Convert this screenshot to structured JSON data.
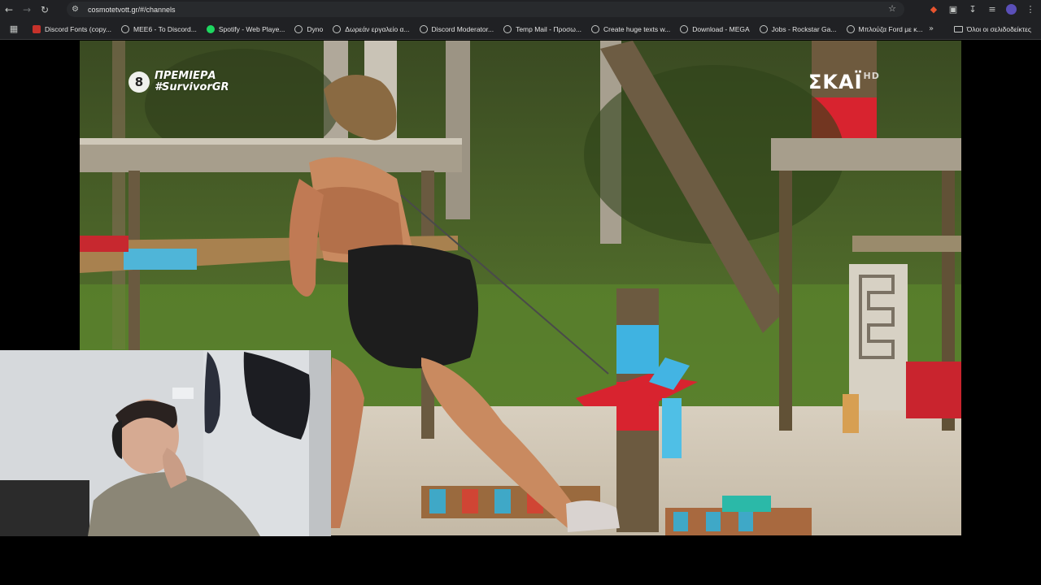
{
  "browser": {
    "url": "cosmotetvott.gr/#/channels",
    "bookmarks": [
      {
        "label": "Discord Fonts (copy...",
        "icon": "red-bookmark-icon"
      },
      {
        "label": "MEE6 - To Discord...",
        "icon": "globe-icon"
      },
      {
        "label": "Spotify - Web Playe...",
        "icon": "spotify-icon"
      },
      {
        "label": "Dyno",
        "icon": "globe-icon"
      },
      {
        "label": "Δωρεάν εργαλείο α...",
        "icon": "globe-icon"
      },
      {
        "label": "Discord Moderator...",
        "icon": "globe-icon"
      },
      {
        "label": "Temp Mail - Προσω...",
        "icon": "globe-icon"
      },
      {
        "label": "Create huge texts w...",
        "icon": "globe-icon"
      },
      {
        "label": "Download - MEGA",
        "icon": "globe-icon"
      },
      {
        "label": "Jobs - Rockstar Ga...",
        "icon": "globe-icon"
      },
      {
        "label": "Μπλούζα Ford με κ...",
        "icon": "globe-icon"
      }
    ],
    "more_label": "»",
    "all_bookmarks_label": "Όλοι οι σελιδοδείκτες"
  },
  "video": {
    "channel_number": "8",
    "premiere_label": "ΠΡΕΜΙΕΡΑ",
    "hashtag": "#SurvivorGR",
    "broadcaster": "ΣΚΑΪ",
    "broadcaster_hd": "HD"
  },
  "colors": {
    "chrome_bg": "#202124",
    "omnibox_bg": "#282a2d",
    "text": "#e3e3e3",
    "accent_cyan": "#35b8e6",
    "accent_red": "#d92b3a"
  }
}
